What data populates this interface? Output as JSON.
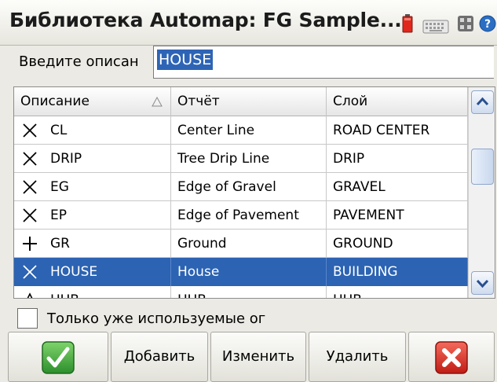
{
  "window": {
    "title": "Библиотека Automap: FG Sample...",
    "icons": [
      "battery-icon",
      "keyboard-icon",
      "grid-icon",
      "help-icon"
    ]
  },
  "search": {
    "label": "Введите описан",
    "value": "HOUSE"
  },
  "table": {
    "columns": [
      "Описание",
      "Отчёт",
      "Слой"
    ],
    "sort_column": "Описание",
    "rows": [
      {
        "icon": "cross-x-icon",
        "code": "CL",
        "report": "Center Line",
        "layer": "ROAD CENTER"
      },
      {
        "icon": "cross-x-icon",
        "code": "DRIP",
        "report": "Tree Drip Line",
        "layer": "DRIP"
      },
      {
        "icon": "cross-x-icon",
        "code": "EG",
        "report": "Edge of Gravel",
        "layer": "GRAVEL"
      },
      {
        "icon": "cross-x-icon",
        "code": "EP",
        "report": "Edge of Pavement",
        "layer": "PAVEMENT"
      },
      {
        "icon": "plus-icon",
        "code": "GR",
        "report": "Ground",
        "layer": "GROUND"
      },
      {
        "icon": "cross-x-icon",
        "code": "HOUSE",
        "report": "House",
        "layer": "BUILDING",
        "selected": true
      },
      {
        "icon": "triangle-icon",
        "code": "HUB",
        "report": "HUB",
        "layer": "HUB"
      }
    ]
  },
  "filter": {
    "label": "Только уже используемые ог",
    "checked": false
  },
  "buttons": {
    "ok": "ok-checkmark-icon",
    "add": "Добавить",
    "edit": "Изменить",
    "delete": "Удалить",
    "cancel": "cancel-x-icon"
  },
  "colors": {
    "selection": "#2c63b3",
    "ok_green": "#3aa53a",
    "cancel_red": "#d92a20"
  }
}
